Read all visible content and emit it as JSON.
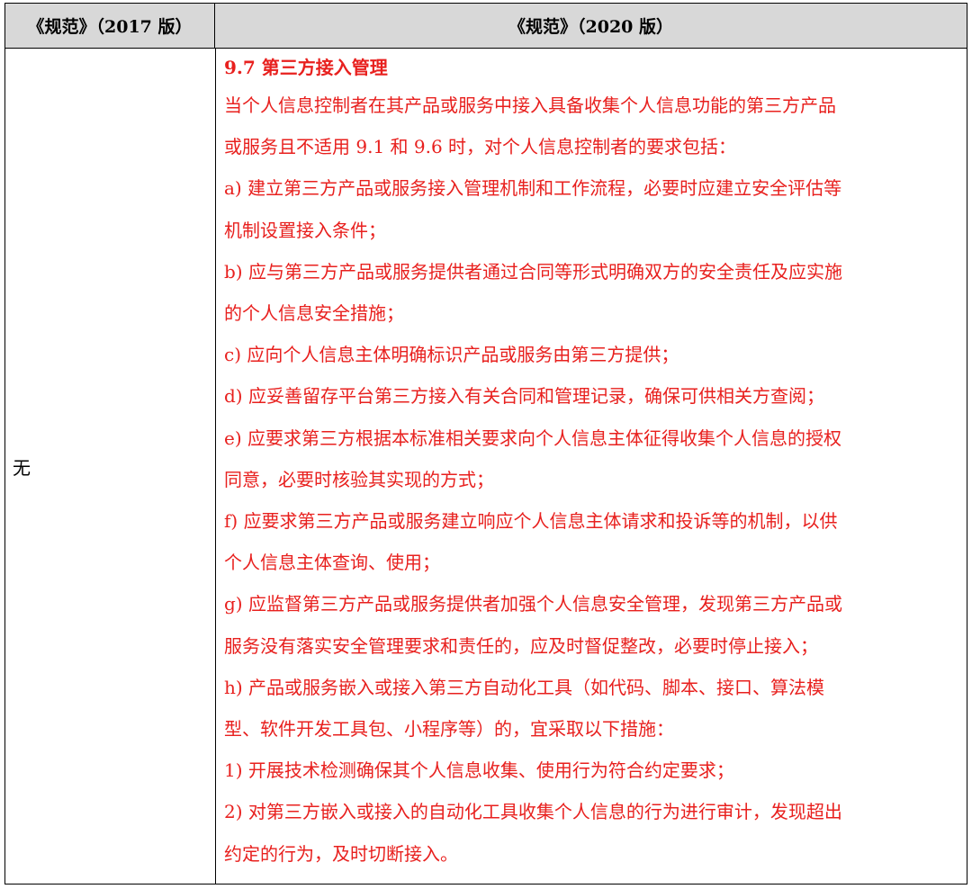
{
  "header": {
    "left": "《规范》（2017 版）",
    "right": "《规范》（2020 版）"
  },
  "left_cell": "无",
  "right_cell": {
    "title": "9.7  第三方接入管理",
    "lines": [
      "当个人信息控制者在其产品或服务中接入具备收集个人信息功能的第三方产品",
      "或服务且不适用 9.1 和 9.6 时，对个人信息控制者的要求包括：",
      "a)  建立第三方产品或服务接入管理机制和工作流程，必要时应建立安全评估等",
      "机制设置接入条件；",
      "b)  应与第三方产品或服务提供者通过合同等形式明确双方的安全责任及应实施",
      "的个人信息安全措施；",
      "c)  应向个人信息主体明确标识产品或服务由第三方提供；",
      "d)  应妥善留存平台第三方接入有关合同和管理记录，确保可供相关方查阅；",
      "e)  应要求第三方根据本标准相关要求向个人信息主体征得收集个人信息的授权",
      "同意，必要时核验其实现的方式；",
      "f)  应要求第三方产品或服务建立响应个人信息主体请求和投诉等的机制，以供",
      "个人信息主体查询、使用；",
      "g)  应监督第三方产品或服务提供者加强个人信息安全管理，发现第三方产品或",
      "服务没有落实安全管理要求和责任的，应及时督促整改，必要时停止接入；",
      "h)  产品或服务嵌入或接入第三方自动化工具（如代码、脚本、接口、算法模",
      "型、软件开发工具包、小程序等）的，宜采取以下措施：",
      "1)  开展技术检测确保其个人信息收集、使用行为符合约定要求；",
      "2)  对第三方嵌入或接入的自动化工具收集个人信息的行为进行审计，发现超出",
      "约定的行为，及时切断接入。"
    ]
  },
  "colors": {
    "header_bg": "#d8d8d8",
    "new_text": "#e8201e",
    "border": "#000000"
  }
}
